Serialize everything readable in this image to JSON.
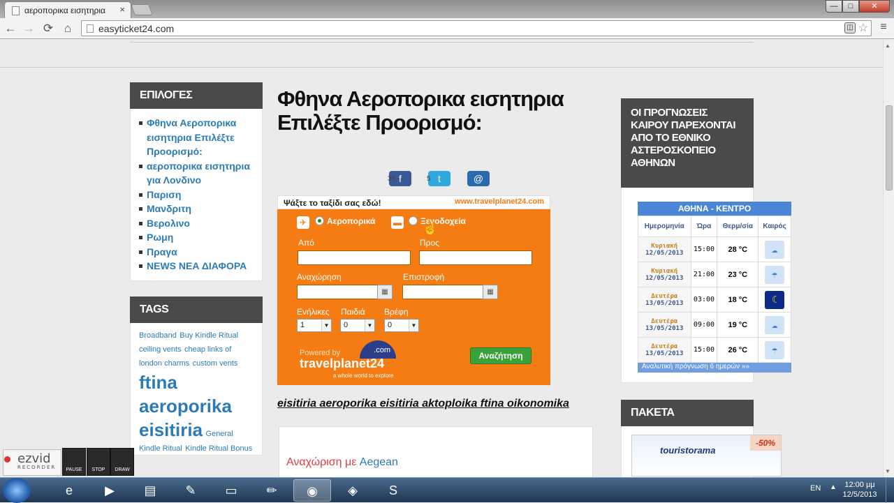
{
  "browser": {
    "tab_title": "αεροπορικα εισητηρια",
    "tab_close": "×",
    "url": "easyticket24.com",
    "window_min": "—",
    "window_max": "□",
    "window_close": "✕",
    "nav_back": "←",
    "nav_forward": "→",
    "nav_reload": "⟳",
    "nav_home": "⌂",
    "wrench": "≡"
  },
  "sidebar_left": {
    "epiloges": {
      "title": "ΕΠΙΛΟΓΕΣ",
      "items": [
        "Φθηνα Αεροπορικα εισητηρια Επιλέξτε Προορισμό:",
        "αεροπορικα εισητηρια για Λονδινο",
        "Παριση",
        "Μανδριτη",
        "Βερολινο",
        "Ρωμη",
        "Πραγα",
        "NEWS ΝΕΑ ΔΙΑΦΟΡΑ"
      ]
    },
    "tags": {
      "title": "TAGS",
      "items": [
        {
          "text": "Broadband",
          "size": "11px"
        },
        {
          "text": "Buy Kindle Ritual",
          "size": "11px"
        },
        {
          "text": "ceiling vents",
          "size": "11px"
        },
        {
          "text": "cheap links of london charms",
          "size": "11px"
        },
        {
          "text": "custom vents",
          "size": "11px"
        },
        {
          "text": "ftina",
          "size": "26px"
        },
        {
          "text": "aeroporika",
          "size": "26px"
        },
        {
          "text": "eisitiria",
          "size": "26px"
        },
        {
          "text": "General",
          "size": "11px"
        },
        {
          "text": "Kindle Ritual",
          "size": "11px"
        },
        {
          "text": "Kindle Ritual Bonus",
          "size": "11px"
        }
      ]
    }
  },
  "main": {
    "title": "Φθηνα Αεροπορικα εισητηρια Επιλέξτε Προορισμό:",
    "share": {
      "facebook_count": "36",
      "twitter_count": "5",
      "facebook_icon": "f",
      "twitter_icon": "t",
      "email_icon": "@"
    },
    "search_widget": {
      "header": "Ψάξτε το ταξίδι σας εδώ!",
      "site": "www.travelplanet24.com",
      "radio_flights": "Αεροπορικά",
      "radio_hotels": "Ξενοδοχεία",
      "from_label": "Από",
      "to_label": "Προς",
      "departure_label": "Αναχώρηση",
      "return_label": "Επιστροφή",
      "adults_label": "Ενήλικες",
      "children_label": "Παιδιά",
      "infants_label": "Βρέφη",
      "adults_value": "1",
      "children_value": "0",
      "infants_value": "0",
      "powered_by": "Powered by",
      "logo": "travelplanet24",
      "logo_dotcom": ".com",
      "tagline": "a whole world to explore",
      "submit": "Αναζήτηση",
      "accent": "#f57c12"
    },
    "seo_link": "eisitiria aeroporika eisitiria aktoploika ftina oikonomika",
    "departure_label": "Αναχώριση με",
    "departure_airline": "Aegean"
  },
  "sidebar_right": {
    "weather": {
      "title": "ΟΙ ΠΡΟΓΝΩΣΕΙΣ ΚΑΙΡΟΥ ΠΑΡΕΧΟΝΤΑΙ ΑΠΟ ΤΟ ΕΘΝΙΚΟ ΑΣΤΕΡΟΣΚΟΠΕΙΟ ΑΘΗΝΩΝ",
      "location": "ΑΘΗΝΑ - ΚΕΝΤΡΟ",
      "columns": [
        "Ημερομηνία",
        "Ώρα",
        "Θερμ/σία",
        "Καιρός"
      ],
      "rows": [
        {
          "day": "Κυριακή",
          "date": "12/05/2013",
          "time": "15:00",
          "temp": "28 °C",
          "icon": "cloudy-sun-icon",
          "glyph": "☁",
          "night": false
        },
        {
          "day": "Κυριακή",
          "date": "12/05/2013",
          "time": "21:00",
          "temp": "23 °C",
          "icon": "rain-icon",
          "glyph": "☂",
          "night": false
        },
        {
          "day": "Δευτέρα",
          "date": "13/05/2013",
          "time": "03:00",
          "temp": "18 °C",
          "icon": "moon-icon",
          "glyph": "☾",
          "night": true
        },
        {
          "day": "Δευτέρα",
          "date": "13/05/2013",
          "time": "09:00",
          "temp": "19 °C",
          "icon": "cloud-icon",
          "glyph": "☁",
          "night": false
        },
        {
          "day": "Δευτέρα",
          "date": "13/05/2013",
          "time": "15:00",
          "temp": "26 °C",
          "icon": "rain-icon",
          "glyph": "☂",
          "night": false
        }
      ],
      "more": "Αναλυτική πρόγνωση 6 ημερών »»"
    },
    "paketa": {
      "title": "ΠΑΚΕΤΑ",
      "banner": "touristorama",
      "banner_discount": "-50%"
    }
  },
  "ezvid": {
    "logo": "ezvid",
    "sub": "RECORDER",
    "pause": "PAUSE",
    "stop": "STOP",
    "draw": "DRAW"
  },
  "taskbar": {
    "lang": "EN",
    "time": "12:00 μμ",
    "date": "12/5/2013",
    "apps": [
      {
        "name": "ie-icon",
        "glyph": "e",
        "active": false
      },
      {
        "name": "media-player-icon",
        "glyph": "▶",
        "active": false
      },
      {
        "name": "explorer-icon",
        "glyph": "▤",
        "active": false
      },
      {
        "name": "tools-icon",
        "glyph": "✎",
        "active": false
      },
      {
        "name": "notepad-icon",
        "glyph": "▭",
        "active": false
      },
      {
        "name": "pencil-icon",
        "glyph": "✏",
        "active": false
      },
      {
        "name": "chrome-icon",
        "glyph": "◉",
        "active": true
      },
      {
        "name": "recorder-icon",
        "glyph": "◈",
        "active": false
      },
      {
        "name": "skype-icon",
        "glyph": "S",
        "active": false
      }
    ]
  }
}
